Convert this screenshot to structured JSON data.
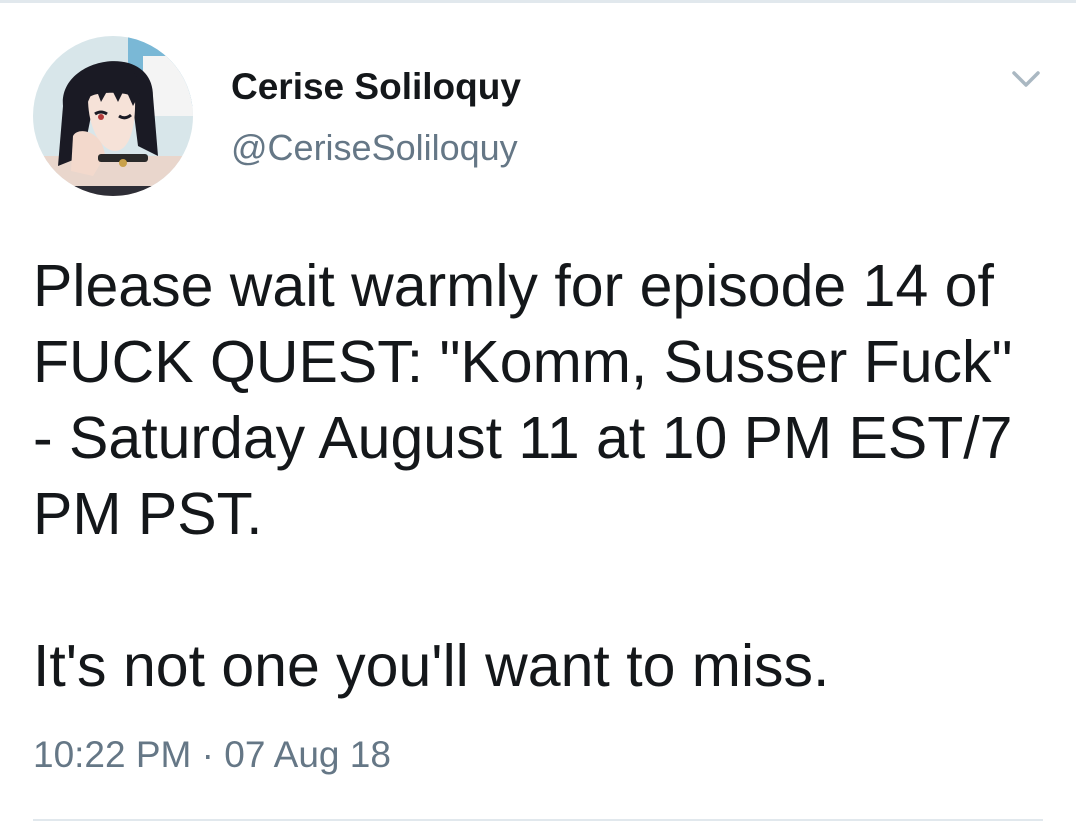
{
  "tweet": {
    "display_name": "Cerise Soliloquy",
    "handle": "@CeriseSoliloquy",
    "text_line_1": "Please wait warmly for episode 14 of FUCK QUEST: \"Komm, Susser Fuck\" - Saturday August 11 at 10 PM EST/7 PM PST.",
    "text_line_2": "It's not one you'll want to miss.",
    "timestamp": "10:22 PM · 07 Aug 18"
  },
  "icons": {
    "menu": "chevron-down-icon",
    "avatar": "avatar"
  },
  "colors": {
    "text": "#14171a",
    "secondary_text": "#657786",
    "divider": "#e1e8ed",
    "caret": "#aab8c2"
  }
}
